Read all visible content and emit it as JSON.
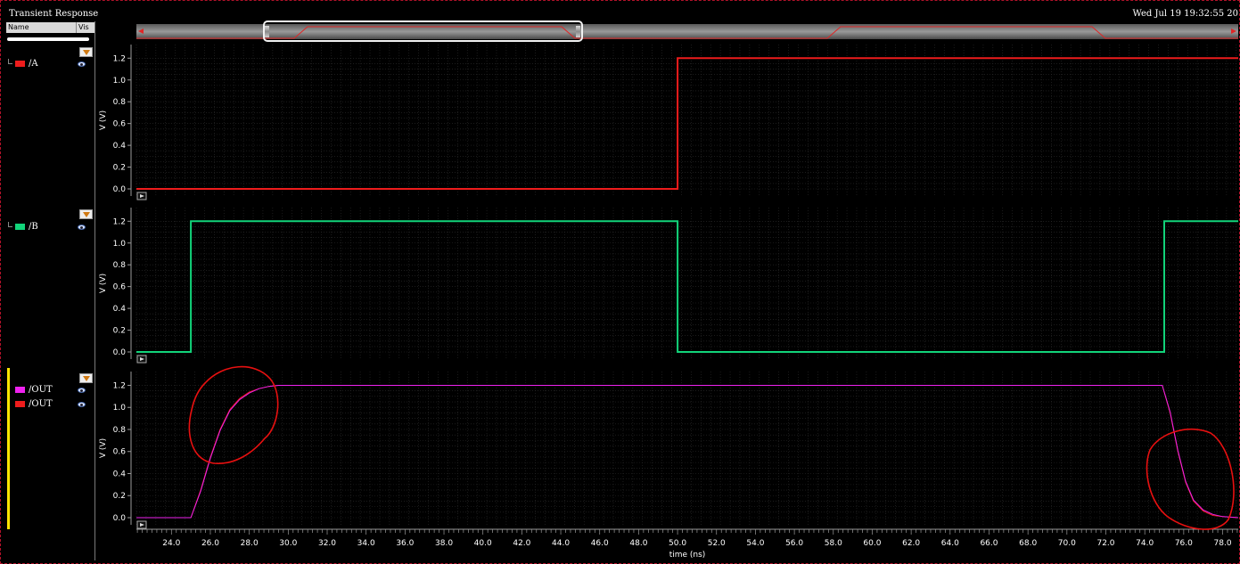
{
  "window": {
    "title": "Transient Response",
    "datetime": "Wed Jul 19 19:32:55 20"
  },
  "sidebar": {
    "header_name": "Name",
    "header_vis": "Vis",
    "signals": [
      {
        "label": "/A",
        "color": "#ee1c1c",
        "panel": 0
      },
      {
        "label": "/B",
        "color": "#12d47a",
        "panel": 1
      },
      {
        "label": "/OUT",
        "color": "#ee22ee",
        "panel": 2
      },
      {
        "label": "/OUT",
        "color": "#ee1c1c",
        "panel": 2
      }
    ]
  },
  "chart_data": {
    "type": "line",
    "xlabel": "time (ns)",
    "ylabel": "V (V)",
    "xlim": [
      22.2,
      78.8
    ],
    "ylim": [
      -0.08,
      1.3
    ],
    "x_ticks": [
      "24.0",
      "26.0",
      "28.0",
      "30.0",
      "32.0",
      "34.0",
      "36.0",
      "38.0",
      "40.0",
      "42.0",
      "44.0",
      "46.0",
      "48.0",
      "50.0",
      "52.0",
      "54.0",
      "56.0",
      "58.0",
      "60.0",
      "62.0",
      "64.0",
      "66.0",
      "68.0",
      "70.0",
      "72.0",
      "74.0",
      "76.0",
      "78.0"
    ],
    "y_ticks": [
      "0.0",
      "0.2",
      "0.4",
      "0.6",
      "0.8",
      "1.0",
      "1.2"
    ],
    "grid": true,
    "panels": [
      {
        "series": [
          {
            "name": "/A",
            "color": "#ee1c1c",
            "x": [
              22.2,
              50.0,
              50.0,
              78.8
            ],
            "y": [
              0.0,
              0.0,
              1.2,
              1.2
            ]
          }
        ]
      },
      {
        "series": [
          {
            "name": "/B",
            "color": "#12d47a",
            "x": [
              22.2,
              25.0,
              25.0,
              50.0,
              50.0,
              75.0,
              75.0,
              78.8
            ],
            "y": [
              0.0,
              0.0,
              1.2,
              1.2,
              0.0,
              0.0,
              1.2,
              1.2
            ]
          }
        ]
      },
      {
        "series": [
          {
            "name": "/OUT",
            "color": "#ee1c1c",
            "x": [
              22.2,
              25.0,
              25.5,
              26.0,
              26.5,
              27.0,
              27.5,
              28.0,
              28.5,
              29.0,
              29.5,
              30.0,
              74.9,
              75.3,
              75.7,
              76.1,
              76.5,
              77.0,
              77.5,
              78.0,
              78.8
            ],
            "y": [
              0.0,
              0.0,
              0.25,
              0.55,
              0.8,
              0.98,
              1.08,
              1.14,
              1.17,
              1.19,
              1.2,
              1.2,
              1.2,
              0.95,
              0.6,
              0.32,
              0.15,
              0.06,
              0.02,
              0.01,
              0.0
            ]
          },
          {
            "name": "/OUT",
            "color": "#ee22ee",
            "x": [
              22.2,
              25.0,
              25.5,
              26.0,
              26.5,
              27.0,
              27.5,
              28.0,
              28.5,
              29.0,
              29.5,
              30.0,
              74.9,
              75.3,
              75.7,
              76.1,
              76.5,
              77.0,
              77.5,
              78.0,
              78.8
            ],
            "y": [
              0.0,
              0.0,
              0.24,
              0.54,
              0.79,
              0.97,
              1.07,
              1.13,
              1.17,
              1.19,
              1.2,
              1.2,
              1.2,
              0.96,
              0.61,
              0.33,
              0.16,
              0.07,
              0.03,
              0.01,
              0.0
            ]
          }
        ]
      }
    ]
  },
  "colors": {
    "annotation": "#e81010",
    "grid": "#2c2c2c",
    "axis": "#9a9a9a"
  }
}
